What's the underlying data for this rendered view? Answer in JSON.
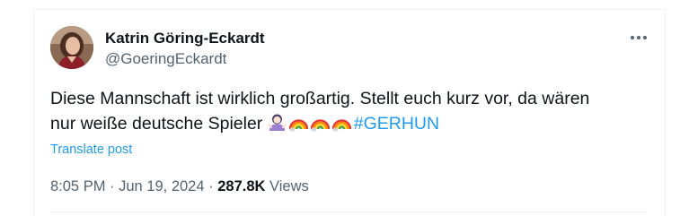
{
  "author": {
    "display_name": "Katrin Göring-Eckardt",
    "handle": "@GoeringEckardt"
  },
  "more_button": {
    "icon": "more-horizontal-icon"
  },
  "tweet": {
    "line1": "Diese Mannschaft ist wirklich großartig. Stellt euch kurz vor, da wären",
    "line2": "nur weiße deutsche Spieler",
    "emojis": [
      "woman-shrugging-emoji",
      "rainbow-emoji",
      "rainbow-emoji",
      "rainbow-emoji"
    ],
    "hashtag": "#GERHUN"
  },
  "translate_label": "Translate post",
  "meta": {
    "time": "8:05 PM",
    "separator": " · ",
    "date": "Jun 19, 2024",
    "views_count": "287.8K",
    "views_label": " Views"
  },
  "colors": {
    "text": "#0f1419",
    "secondary": "#536471",
    "link": "#1d9bf0",
    "border": "#eff3f4"
  }
}
